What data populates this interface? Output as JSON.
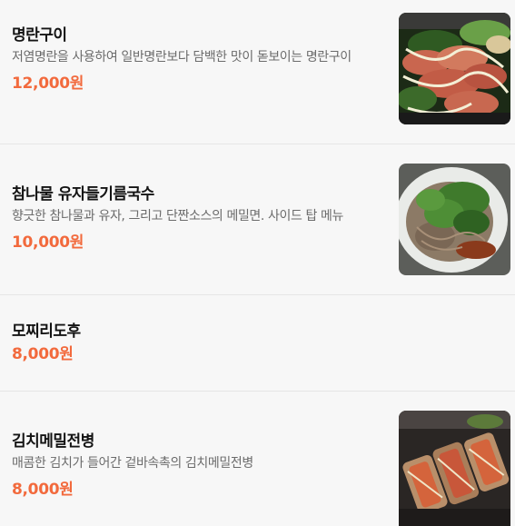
{
  "menu": {
    "items": [
      {
        "name": "명란구이",
        "description": "저염명란을 사용하여 일반명란보다 담백한 맛이 돋보이는 명란구이",
        "price": "12,000원",
        "image": "grilled-pollock-roe-photo"
      },
      {
        "name": "참나물 유자들기름국수",
        "description": "향긋한 참나물과 유자, 그리고 단짠소스의 메밀면. 사이드 탑 메뉴",
        "price": "10,000원",
        "image": "perilla-oil-noodle-photo"
      },
      {
        "name": "모찌리도후",
        "description": "",
        "price": "8,000원"
      },
      {
        "name": "김치메밀전병",
        "description": "매콤한 김치가 들어간 겉바속촉의 김치메밀전병",
        "price": "8,000원",
        "image": "kimchi-buckwheat-crepe-photo"
      }
    ]
  },
  "colors": {
    "price": "#f26a3d",
    "divider": "#e6e6e6",
    "background": "#f7f7f7"
  }
}
